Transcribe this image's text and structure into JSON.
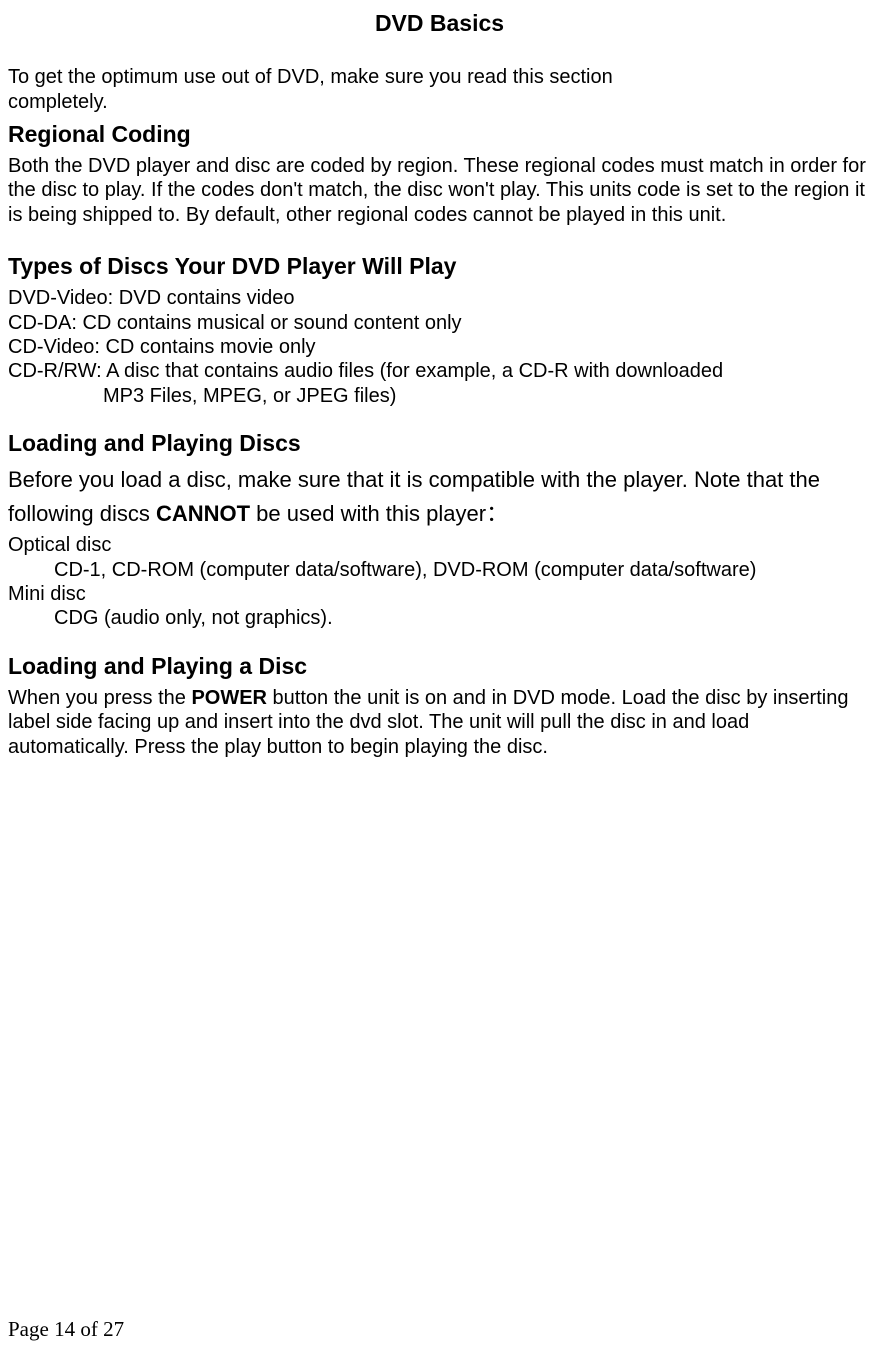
{
  "page_title": "DVD Basics",
  "intro": "To get the optimum use out of DVD, make sure you read this section completely.",
  "regional": {
    "heading": "Regional Coding",
    "text": "Both the DVD player and disc are coded by region. These regional codes must match in order for the disc to play. If the codes don't match, the disc won't play. This units code is set to the region it is being shipped to. By default, other regional codes cannot be played in this unit."
  },
  "types": {
    "heading": "Types of Discs Your DVD Player Will Play",
    "line1": "DVD-Video: DVD contains video",
    "line2": "CD-DA: CD contains musical or sound content only",
    "line3": "CD-Video: CD contains movie only",
    "line4": "CD-R/RW: A disc that contains audio files (for example, a CD-R with downloaded",
    "line5": "MP3 Files, MPEG, or JPEG files)"
  },
  "loading_discs": {
    "heading": "Loading and Playing Discs",
    "intro_before": "Before you load a disc, make sure that it is compatible with the player. Note that the following discs ",
    "intro_emph": "CANNOT",
    "intro_after": " be used with this player：",
    "line1": "Optical disc",
    "line2": "CD-1, CD-ROM (computer data/software), DVD-ROM (computer data/software)",
    "line3": "Mini disc",
    "line4": "CDG (audio only, not graphics)."
  },
  "loading_a_disc": {
    "heading": "Loading and Playing a Disc",
    "text_before": "When you press the ",
    "text_emph": "POWER",
    "text_after": " button the unit is on and in DVD mode. Load the disc by inserting label side facing up and insert into the dvd slot. The unit will pull the disc in and load automatically. Press the play button to begin playing the disc."
  },
  "footer": "Page 14 of 27"
}
